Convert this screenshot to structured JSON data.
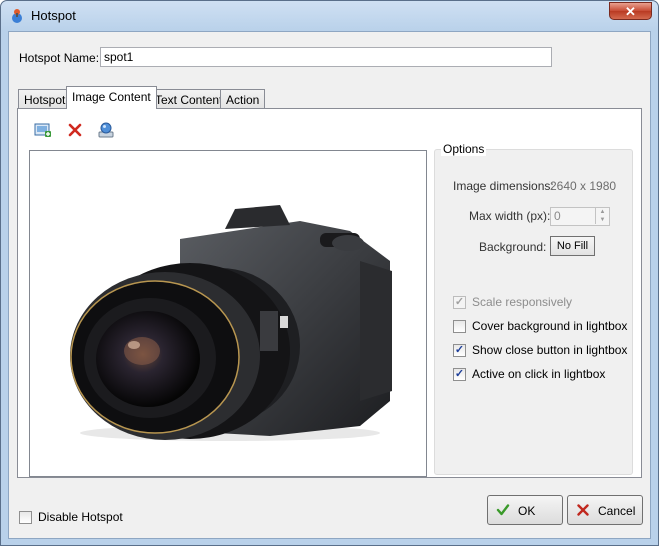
{
  "window": {
    "title": "Hotspot",
    "close_glyph": "✕"
  },
  "hotspot_name": {
    "label": "Hotspot Name:",
    "value": "spot1"
  },
  "tabs": [
    {
      "label": "Hotspot",
      "active": false
    },
    {
      "label": "Image Content",
      "active": true
    },
    {
      "label": "Text Content",
      "active": false
    },
    {
      "label": "Action",
      "active": false
    }
  ],
  "toolbar": {
    "add_icon": "add-image-icon",
    "delete_icon": "delete-icon",
    "edit_icon": "edit-image-icon"
  },
  "options": {
    "legend": "Options",
    "image_dimensions_label": "Image dimensions:",
    "image_dimensions_value": "2640 x 1980",
    "max_width_label": "Max width (px):",
    "max_width_value": "0",
    "background_label": "Background:",
    "background_button": "No Fill",
    "checkboxes": [
      {
        "label": "Scale responsively",
        "checked": true,
        "disabled": true
      },
      {
        "label": "Cover background in lightbox",
        "checked": false,
        "disabled": false
      },
      {
        "label": "Show close button in lightbox",
        "checked": true,
        "disabled": false
      },
      {
        "label": "Active on click in lightbox",
        "checked": true,
        "disabled": false
      }
    ]
  },
  "disable_hotspot": {
    "label": "Disable Hotspot",
    "checked": false
  },
  "buttons": {
    "ok": "OK",
    "cancel": "Cancel"
  },
  "colors": {
    "accent_check": "#1e3f9a",
    "ok_green": "#3a9a2a",
    "cancel_red": "#c0281e"
  }
}
